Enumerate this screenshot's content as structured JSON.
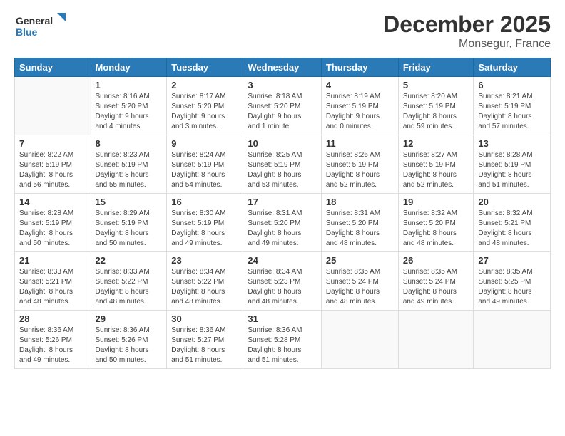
{
  "logo": {
    "line1": "General",
    "line2": "Blue"
  },
  "title": "December 2025",
  "subtitle": "Monsegur, France",
  "headers": [
    "Sunday",
    "Monday",
    "Tuesday",
    "Wednesday",
    "Thursday",
    "Friday",
    "Saturday"
  ],
  "weeks": [
    [
      {
        "num": "",
        "info": ""
      },
      {
        "num": "1",
        "info": "Sunrise: 8:16 AM\nSunset: 5:20 PM\nDaylight: 9 hours\nand 4 minutes."
      },
      {
        "num": "2",
        "info": "Sunrise: 8:17 AM\nSunset: 5:20 PM\nDaylight: 9 hours\nand 3 minutes."
      },
      {
        "num": "3",
        "info": "Sunrise: 8:18 AM\nSunset: 5:20 PM\nDaylight: 9 hours\nand 1 minute."
      },
      {
        "num": "4",
        "info": "Sunrise: 8:19 AM\nSunset: 5:19 PM\nDaylight: 9 hours\nand 0 minutes."
      },
      {
        "num": "5",
        "info": "Sunrise: 8:20 AM\nSunset: 5:19 PM\nDaylight: 8 hours\nand 59 minutes."
      },
      {
        "num": "6",
        "info": "Sunrise: 8:21 AM\nSunset: 5:19 PM\nDaylight: 8 hours\nand 57 minutes."
      }
    ],
    [
      {
        "num": "7",
        "info": "Sunrise: 8:22 AM\nSunset: 5:19 PM\nDaylight: 8 hours\nand 56 minutes."
      },
      {
        "num": "8",
        "info": "Sunrise: 8:23 AM\nSunset: 5:19 PM\nDaylight: 8 hours\nand 55 minutes."
      },
      {
        "num": "9",
        "info": "Sunrise: 8:24 AM\nSunset: 5:19 PM\nDaylight: 8 hours\nand 54 minutes."
      },
      {
        "num": "10",
        "info": "Sunrise: 8:25 AM\nSunset: 5:19 PM\nDaylight: 8 hours\nand 53 minutes."
      },
      {
        "num": "11",
        "info": "Sunrise: 8:26 AM\nSunset: 5:19 PM\nDaylight: 8 hours\nand 52 minutes."
      },
      {
        "num": "12",
        "info": "Sunrise: 8:27 AM\nSunset: 5:19 PM\nDaylight: 8 hours\nand 52 minutes."
      },
      {
        "num": "13",
        "info": "Sunrise: 8:28 AM\nSunset: 5:19 PM\nDaylight: 8 hours\nand 51 minutes."
      }
    ],
    [
      {
        "num": "14",
        "info": "Sunrise: 8:28 AM\nSunset: 5:19 PM\nDaylight: 8 hours\nand 50 minutes."
      },
      {
        "num": "15",
        "info": "Sunrise: 8:29 AM\nSunset: 5:19 PM\nDaylight: 8 hours\nand 50 minutes."
      },
      {
        "num": "16",
        "info": "Sunrise: 8:30 AM\nSunset: 5:19 PM\nDaylight: 8 hours\nand 49 minutes."
      },
      {
        "num": "17",
        "info": "Sunrise: 8:31 AM\nSunset: 5:20 PM\nDaylight: 8 hours\nand 49 minutes."
      },
      {
        "num": "18",
        "info": "Sunrise: 8:31 AM\nSunset: 5:20 PM\nDaylight: 8 hours\nand 48 minutes."
      },
      {
        "num": "19",
        "info": "Sunrise: 8:32 AM\nSunset: 5:20 PM\nDaylight: 8 hours\nand 48 minutes."
      },
      {
        "num": "20",
        "info": "Sunrise: 8:32 AM\nSunset: 5:21 PM\nDaylight: 8 hours\nand 48 minutes."
      }
    ],
    [
      {
        "num": "21",
        "info": "Sunrise: 8:33 AM\nSunset: 5:21 PM\nDaylight: 8 hours\nand 48 minutes."
      },
      {
        "num": "22",
        "info": "Sunrise: 8:33 AM\nSunset: 5:22 PM\nDaylight: 8 hours\nand 48 minutes."
      },
      {
        "num": "23",
        "info": "Sunrise: 8:34 AM\nSunset: 5:22 PM\nDaylight: 8 hours\nand 48 minutes."
      },
      {
        "num": "24",
        "info": "Sunrise: 8:34 AM\nSunset: 5:23 PM\nDaylight: 8 hours\nand 48 minutes."
      },
      {
        "num": "25",
        "info": "Sunrise: 8:35 AM\nSunset: 5:24 PM\nDaylight: 8 hours\nand 48 minutes."
      },
      {
        "num": "26",
        "info": "Sunrise: 8:35 AM\nSunset: 5:24 PM\nDaylight: 8 hours\nand 49 minutes."
      },
      {
        "num": "27",
        "info": "Sunrise: 8:35 AM\nSunset: 5:25 PM\nDaylight: 8 hours\nand 49 minutes."
      }
    ],
    [
      {
        "num": "28",
        "info": "Sunrise: 8:36 AM\nSunset: 5:26 PM\nDaylight: 8 hours\nand 49 minutes."
      },
      {
        "num": "29",
        "info": "Sunrise: 8:36 AM\nSunset: 5:26 PM\nDaylight: 8 hours\nand 50 minutes."
      },
      {
        "num": "30",
        "info": "Sunrise: 8:36 AM\nSunset: 5:27 PM\nDaylight: 8 hours\nand 51 minutes."
      },
      {
        "num": "31",
        "info": "Sunrise: 8:36 AM\nSunset: 5:28 PM\nDaylight: 8 hours\nand 51 minutes."
      },
      {
        "num": "",
        "info": ""
      },
      {
        "num": "",
        "info": ""
      },
      {
        "num": "",
        "info": ""
      }
    ]
  ]
}
